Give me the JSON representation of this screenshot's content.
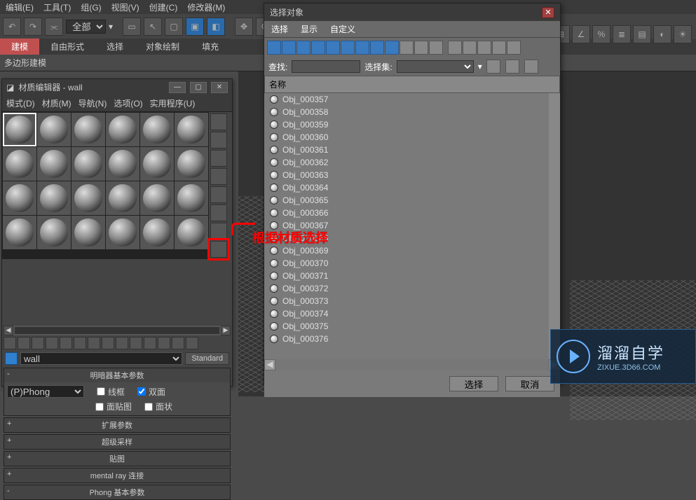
{
  "main_menu": {
    "items": [
      "编辑(E)",
      "工具(T)",
      "组(G)",
      "视图(V)",
      "创建(C)",
      "修改器(M)"
    ]
  },
  "toolbar": {
    "scope_label": "全部",
    "scope_arrow": "▾"
  },
  "ribbon": {
    "tabs": [
      "建模",
      "自由形式",
      "选择",
      "对象绘制",
      "填充"
    ],
    "sub": "多边形建模"
  },
  "mat_editor": {
    "title": "材质编辑器 - wall",
    "menus": [
      "模式(D)",
      "材质(M)",
      "导航(N)",
      "选项(O)",
      "实用程序(U)"
    ],
    "name": "wall",
    "std_btn": "Standard",
    "shader_rollout": "明暗器基本参数",
    "shader_select": "(P)Phong",
    "chk_wire": "线框",
    "chk_2side": "双面",
    "chk_facemap": "面贴图",
    "chk_faceted": "面状",
    "rollouts": [
      "扩展参数",
      "超级采样",
      "贴图",
      "mental ray 连接",
      "Phong 基本参数"
    ]
  },
  "select_dialog": {
    "title": "选择对象",
    "menus": [
      "选择",
      "显示",
      "自定义"
    ],
    "find_label": "查找:",
    "set_label": "选择集:",
    "header": "名称",
    "items": [
      "Obj_000357",
      "Obj_000358",
      "Obj_000359",
      "Obj_000360",
      "Obj_000361",
      "Obj_000362",
      "Obj_000363",
      "Obj_000364",
      "Obj_000365",
      "Obj_000366",
      "Obj_000367",
      "Obj_000368",
      "Obj_000369",
      "Obj_000370",
      "Obj_000371",
      "Obj_000372",
      "Obj_000373",
      "Obj_000374",
      "Obj_000375",
      "Obj_000376"
    ],
    "btn_select": "选择",
    "btn_cancel": "取消"
  },
  "annotation": "根据材质选择",
  "logo": {
    "big": "溜溜自学",
    "small": "ZIXUE.3D66.COM"
  }
}
